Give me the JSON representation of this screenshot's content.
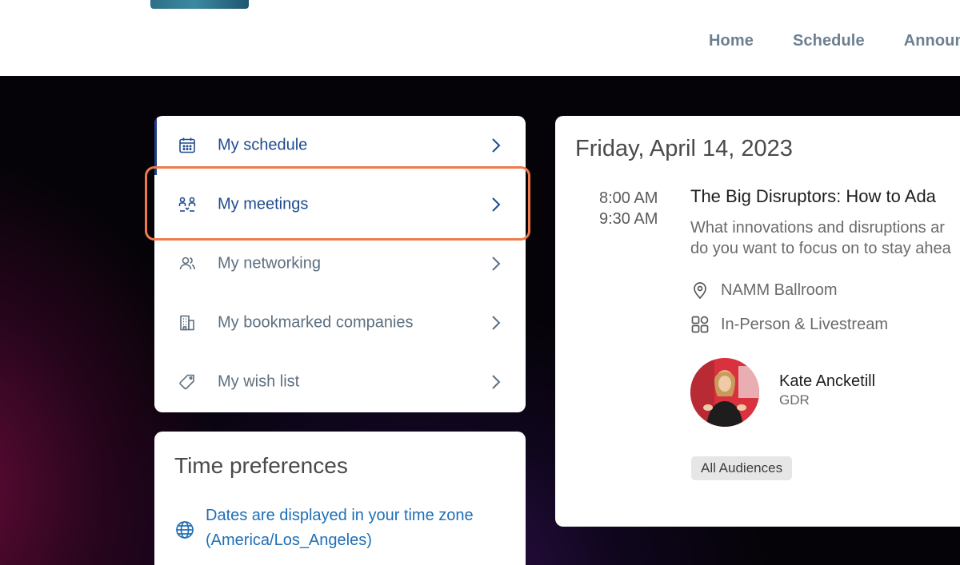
{
  "nav": {
    "items": [
      "Home",
      "Schedule",
      "Announ"
    ]
  },
  "menu": {
    "items": [
      {
        "label": "My schedule",
        "icon": "calendar-icon"
      },
      {
        "label": "My meetings",
        "icon": "meetings-icon"
      },
      {
        "label": "My networking",
        "icon": "people-icon"
      },
      {
        "label": "My bookmarked companies",
        "icon": "building-icon"
      },
      {
        "label": "My wish list",
        "icon": "tag-icon"
      }
    ]
  },
  "time_preferences": {
    "title": "Time preferences",
    "text_line1": "Dates are displayed in your time zone",
    "text_line2": "(America/Los_Angeles)",
    "icon": "globe-icon"
  },
  "session": {
    "date": "Friday, April 14, 2023",
    "start_time": "8:00 AM",
    "end_time": "9:30 AM",
    "title": "The Big Disruptors: How to Ada",
    "description_line1": "What innovations and disruptions ar",
    "description_line2": "do you want to focus on to stay ahea",
    "location": "NAMM Ballroom",
    "format": "In-Person & Livestream",
    "speaker": {
      "name": "Kate Ancketill",
      "org": "GDR"
    },
    "audience_badge": "All Audiences"
  },
  "colors": {
    "accent_blue": "#1e4a8e",
    "link_blue": "#1f6fb5",
    "highlight_orange": "#f07a4a",
    "nav_gray": "#6c7f90"
  }
}
